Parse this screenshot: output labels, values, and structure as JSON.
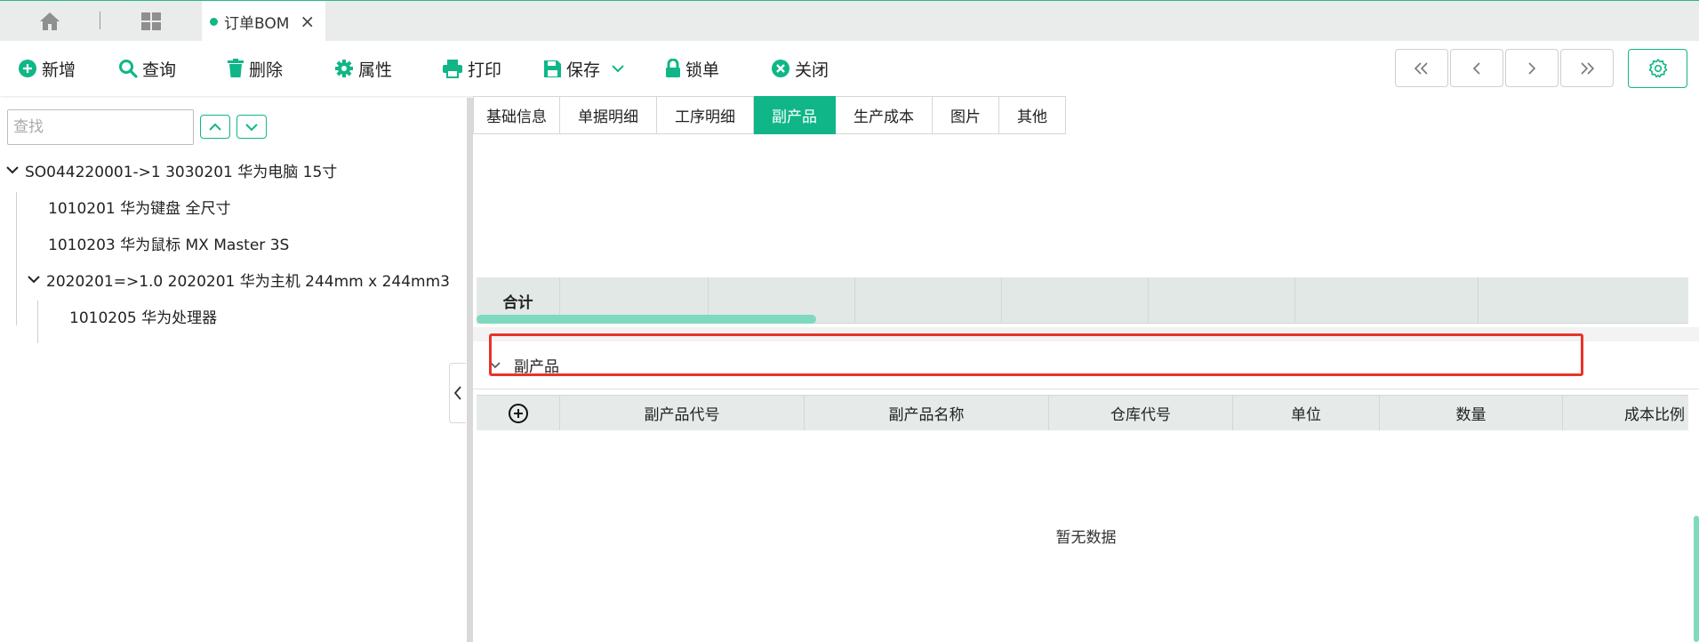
{
  "tabs": {
    "home_icon": "home-icon",
    "apps_icon": "grid-icon",
    "active_label": "订单BOM",
    "close_glyph": "×"
  },
  "toolbar": {
    "add": "新增",
    "query": "查询",
    "delete": "删除",
    "properties": "属性",
    "print": "打印",
    "save": "保存",
    "lock": "锁单",
    "close": "关闭"
  },
  "tree": {
    "search_placeholder": "查找",
    "root": "SO044220001->1 3030201 华为电脑 15寸",
    "children": [
      "1010201 华为键盘 全尺寸",
      "1010203 华为鼠标 MX Master 3S",
      "2020201=>1.0 2020201 华为主机 244mm x 244mm3",
      "1010205 华为处理器"
    ]
  },
  "content_tabs": [
    "基础信息",
    "单据明细",
    "工序明细",
    "副产品",
    "生产成本",
    "图片",
    "其他"
  ],
  "active_tab_index": 3,
  "summary": {
    "label": "合计"
  },
  "section": {
    "title": "副产品"
  },
  "grid": {
    "columns": [
      "副产品代号",
      "副产品名称",
      "仓库代号",
      "单位",
      "数量",
      "成本比例"
    ],
    "empty_text": "暂无数据"
  },
  "colors": {
    "accent": "#10b687",
    "highlight": "#e8332a"
  }
}
